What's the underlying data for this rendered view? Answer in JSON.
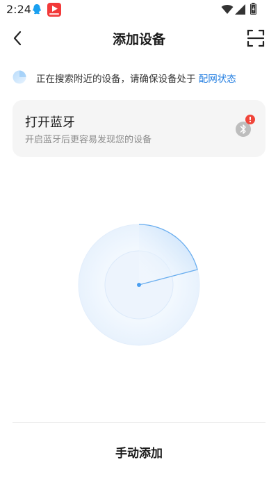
{
  "status_bar": {
    "time": "2:24",
    "icons": [
      "qq-icon",
      "video-app-icon",
      "wifi-icon",
      "signal-icon",
      "battery-icon"
    ]
  },
  "header": {
    "title": "添加设备",
    "back_icon": "chevron-left-icon",
    "scan_icon": "scan-icon"
  },
  "notice": {
    "text": "正在搜索附近的设备，请确保设备处于",
    "link": "配网状态"
  },
  "bluetooth_card": {
    "title": "打开蓝牙",
    "subtitle": "开启蓝牙后更容易发现您的设备",
    "icon": "bluetooth-off-icon",
    "badge": "!"
  },
  "bottom": {
    "manual_add_label": "手动添加"
  },
  "colors": {
    "accent_blue": "#1e7be0",
    "radar_blue": "#4a9ef0",
    "alert_red": "#f0453a",
    "card_bg": "#f5f5f5"
  }
}
